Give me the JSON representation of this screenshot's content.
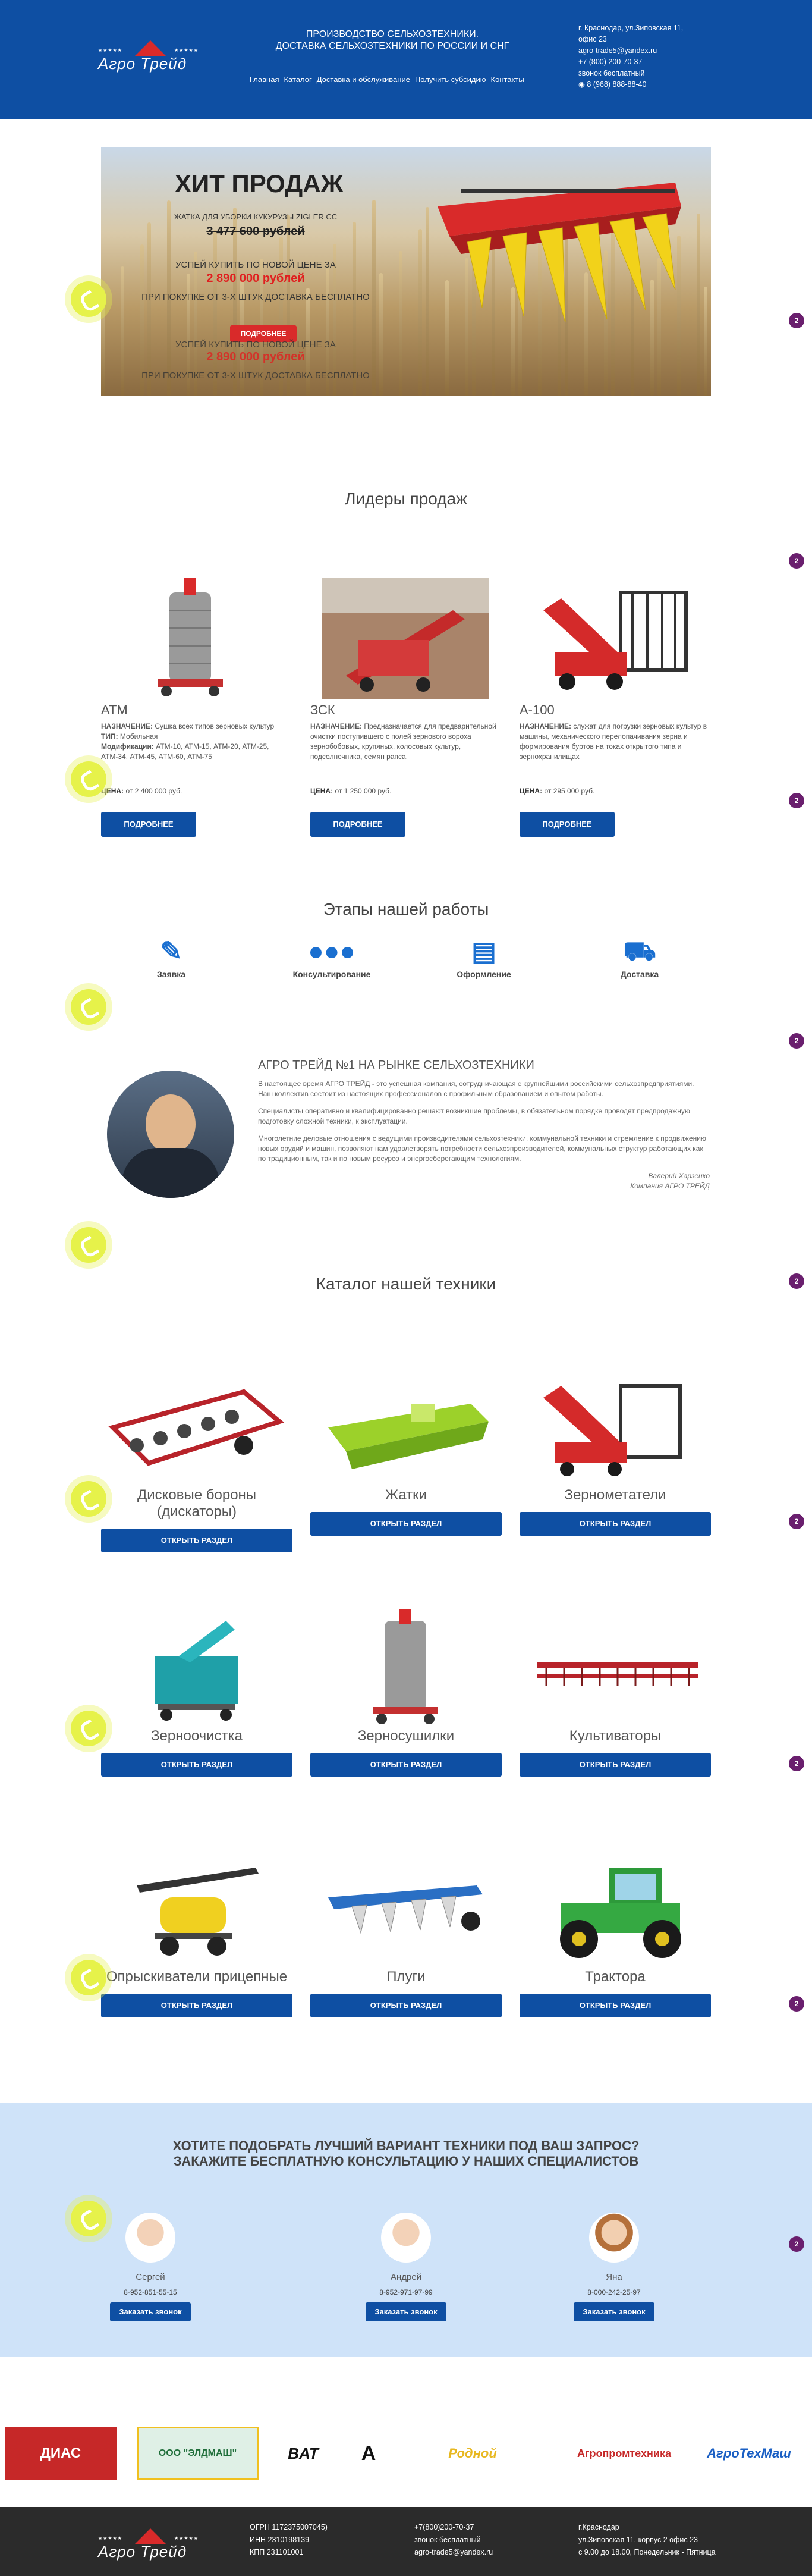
{
  "header": {
    "logo_text": "Агро Трейд",
    "logo_stars": "★★★★★",
    "tagline_1": "ПРОИЗВОДСТВО СЕЛЬХОЗТЕХНИКИ.",
    "tagline_2": "ДОСТАВКА СЕЛЬХОЗТЕХНИКИ ПО РОССИИ И СНГ",
    "nav": [
      "Главная",
      "Каталог",
      "Доставка и обслуживание",
      "Получить субсидию",
      "Контакты"
    ],
    "contacts": {
      "address_1": "г. Краснодар, ул.Зиповская 11,",
      "address_2": "офис 23",
      "email": "agro-trade5@yandex.ru",
      "phone_1": "+7 (800) 200-70-37",
      "free_call": "звонок бесплатный",
      "phone_2": "8 (968) 888-88-40"
    },
    "colors": {
      "primary": "#0e4fa3",
      "accent": "#d92a2a"
    }
  },
  "hero": {
    "title": "ХИТ ПРОДАЖ",
    "subtitle": "ЖАТКА ДЛЯ УБОРКИ КУКУРУЗЫ ZIGLER CC",
    "old_price": "3 477 600 рублей",
    "offer": "УСПЕЙ КУПИТЬ ПО НОВОЙ ЦЕНЕ ЗА",
    "new_price": "2 890 000 рублей",
    "delivery": "ПРИ ПОКУПКЕ ОТ 3-Х ШТУК ДОСТАВКА БЕСПЛАТНО",
    "button": "ПОДРОБНЕЕ"
  },
  "leaders": {
    "title": "Лидеры продаж",
    "label_purpose": "НАЗНАЧЕНИЕ:",
    "label_type": "ТИП:",
    "label_mods": "Модификации:",
    "label_price": "ЦЕНА:",
    "button": "ПОДРОБНЕЕ",
    "items": [
      {
        "name": "АТМ",
        "purpose": "Сушка всех типов зерновых культур",
        "type": "Мобильная",
        "mods": "АТМ-10, АТМ-15, АТМ-20, АТМ-25, АТМ-34, АТМ-45, АТМ-60, АТМ-75",
        "price": "от 2 400 000 руб."
      },
      {
        "name": "ЗСК",
        "purpose": "Предназначается для предварительной очистки поступившего с полей зернового вороха зернобобовых, крупяных, колосовых культур, подсолнечника, семян рапса.",
        "price": "от 1 250 000 руб."
      },
      {
        "name": "А-100",
        "purpose": "служат для погрузки зерновых культур в машины, механического перелопачивания зерна и формирования буртов на токах открытого типа и зернохранилищах",
        "price": "от 295 000 руб."
      }
    ]
  },
  "stages": {
    "title": "Этапы нашей работы",
    "items": [
      {
        "label": "Заявка",
        "icon": "edit-icon"
      },
      {
        "label": "Консультирование",
        "icon": "users-icon"
      },
      {
        "label": "Оформление",
        "icon": "clipboard-icon"
      },
      {
        "label": "Доставка",
        "icon": "truck-icon"
      }
    ]
  },
  "about": {
    "title": "АГРО ТРЕЙД №1 НА РЫНКЕ СЕЛЬХОЗТЕХНИКИ",
    "p1": "В настоящее время АГРО ТРЕЙД - это успешная компания, сотрудничающая с крупнейшими российскими сельхозпредприятиями. Наш коллектив состоит из настоящих профессионалов с профильным образованием и опытом работы.",
    "p2": "Специалисты оперативно и квалифицированно решают возникшие проблемы, в обязательном порядке проводят предпродажную подготовку сложной техники, к эксплуатации.",
    "p3": "Многолетние деловые отношения с ведущими производителями сельхозтехники, коммунальной техники и стремление к продвижению новых орудий и машин, позволяют нам удовлетворять потребности сельхозпроизводителей, коммунальных структур работающих как по традиционным, так и по новым ресурсо и энергосберегающим технологиям.",
    "sign_name": "Валерий Харзенко",
    "sign_company": "Компания АГРО ТРЕЙД"
  },
  "catalog": {
    "title": "Каталог нашей техники",
    "button": "ОТКРЫТЬ РАЗДЕЛ",
    "items": [
      "Дисковые бороны (дискаторы)",
      "Жатки",
      "Зернометатели",
      "Зерноочистка",
      "Зерносушилки",
      "Культиваторы",
      "Опрыскиватели прицепные",
      "Плуги",
      "Трактора"
    ]
  },
  "consult": {
    "title_1": "ХОТИТЕ ПОДОБРАТЬ ЛУЧШИЙ ВАРИАНТ ТЕХНИКИ ПОД ВАШ ЗАПРОС?",
    "title_2": "ЗАКАЖИТЕ БЕСПЛАТНУЮ КОНСУЛЬТАЦИЮ У НАШИХ СПЕЦИАЛИСТОВ",
    "button": "Заказать звонок",
    "people": [
      {
        "name": "Сергей",
        "phone": "8-952-851-55-15"
      },
      {
        "name": "Андрей",
        "phone": "8-952-971-97-99"
      },
      {
        "name": "Яна",
        "phone": "8-000-242-25-97"
      }
    ]
  },
  "partners": [
    "ДИАС",
    "ООО \"ЭЛДМАШ\"",
    "BAT",
    "A",
    "Родной",
    "Агропромтехника",
    "АгроТехМаш"
  ],
  "footer": {
    "logo_text": "Агро Трейд",
    "ogrn": "ОГРН 1172375007045)",
    "inn": "ИНН 2310198139",
    "kpp": "КПП 231101001",
    "phone": "+7(800)200-70-37",
    "free_call": "звонок бесплатный",
    "email": "agro-trade5@yandex.ru",
    "city": "г.Краснодар",
    "address": "ул.Зиповская 11, корпус 2 офис 23",
    "hours": "с 9.00 до 18.00, Понедельник - Пятница"
  },
  "widgets": {
    "badge_count": "2"
  }
}
